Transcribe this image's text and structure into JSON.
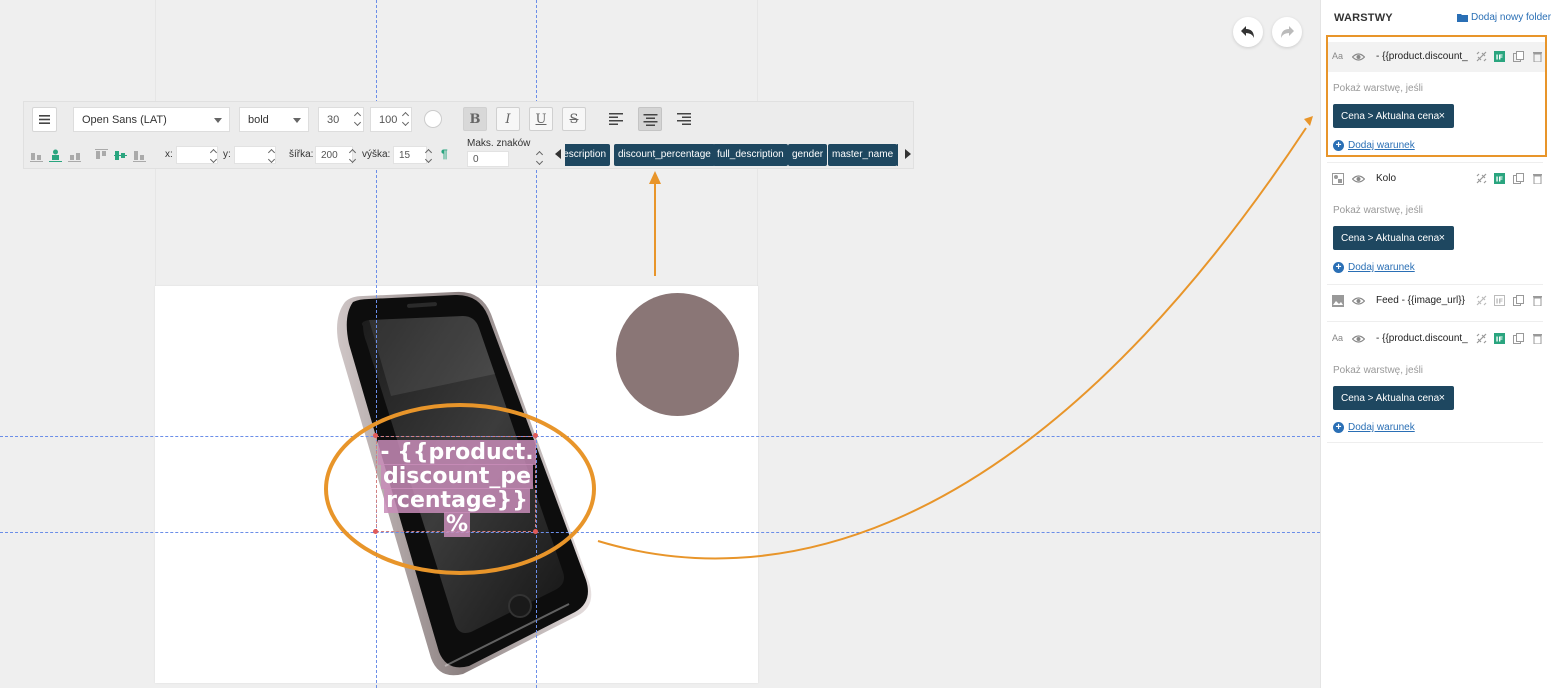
{
  "toolbar": {
    "font_family": "Open Sans (LAT)",
    "font_weight": "bold",
    "font_size": "30",
    "line_height": "100",
    "bold_label": "B",
    "italic_label": "I",
    "underline_label": "U",
    "strike_label": "S",
    "x_label": "x:",
    "y_label": "y:",
    "x_value": "",
    "y_value": "",
    "width_label": "šířka:",
    "width_value": "200",
    "height_label": "výška:",
    "height_value": "15",
    "max_chars_label": "Maks. znaków",
    "max_chars_value": "0",
    "variables": [
      "description",
      "discount_percentage",
      "full_description",
      "gender",
      "master_name"
    ]
  },
  "canvas": {
    "text_layer_text": "- {{product.discount_percentage}} %",
    "circle_color": "#8a7676"
  },
  "sidebar": {
    "title": "WARSTWY",
    "add_folder_label": "Dodaj nowy folder",
    "layers": [
      {
        "type_icon": "text-icon",
        "name": "- {{product.discount_percentage}} %",
        "condition_label": "Pokaż warstwę, jeśli",
        "condition": "Cena > Aktualna cena",
        "add_condition_label": "Dodaj warunek"
      },
      {
        "type_icon": "shape-icon",
        "name": "Kolo",
        "condition_label": "Pokaż warstwę, jeśli",
        "condition": "Cena > Aktualna cena",
        "add_condition_label": "Dodaj warunek"
      },
      {
        "type_icon": "image-icon",
        "name": "Feed - {{image_url}}"
      },
      {
        "type_icon": "text-icon",
        "name": "- {{product.discount_percentage}} %",
        "condition_label": "Pokaż warstwę, jeśli",
        "condition": "Cena > Aktualna cena",
        "add_condition_label": "Dodaj warunek"
      }
    ]
  },
  "colors": {
    "accent_orange": "#e8952a",
    "tag_navy": "#1e4760",
    "link_blue": "#2a6fb5",
    "guide_blue": "#6b8ee8"
  }
}
